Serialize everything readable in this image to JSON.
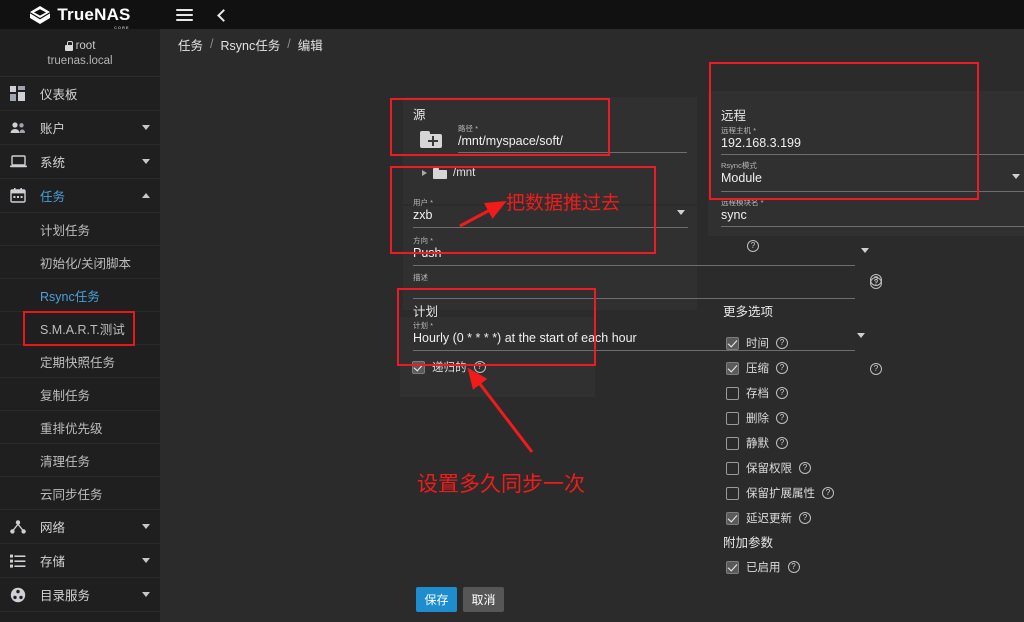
{
  "app": {
    "brand": "TrueNAS",
    "brand_sub": "CORE",
    "logo_icon": "truenas-diamond-logo",
    "menu_icon": "hamburger-menu-icon",
    "back_icon": "chevron-left-icon"
  },
  "sidebar": {
    "user": "root",
    "user_icon": "lock-icon",
    "host": "truenas.local",
    "items": [
      {
        "label": "仪表板",
        "icon": "dashboard-icon",
        "expandable": false
      },
      {
        "label": "账户",
        "icon": "users-icon",
        "expandable": true,
        "expanded": false
      },
      {
        "label": "系统",
        "icon": "laptop-icon",
        "expandable": true,
        "expanded": false
      },
      {
        "label": "任务",
        "icon": "calendar-icon",
        "expandable": true,
        "expanded": true,
        "active": true
      }
    ],
    "task_sub_items": [
      {
        "label": "计划任务",
        "selected": false
      },
      {
        "label": "初始化/关闭脚本",
        "selected": false
      },
      {
        "label": "Rsync任务",
        "selected": true
      },
      {
        "label": "S.M.A.R.T.测试",
        "selected": false
      },
      {
        "label": "定期快照任务",
        "selected": false
      },
      {
        "label": "复制任务",
        "selected": false
      },
      {
        "label": "重排优先级",
        "selected": false
      },
      {
        "label": "清理任务",
        "selected": false
      },
      {
        "label": "云同步任务",
        "selected": false
      }
    ],
    "bottom_items": [
      {
        "label": "网络",
        "icon": "network-icon",
        "expandable": true
      },
      {
        "label": "存储",
        "icon": "storage-icon",
        "expandable": true
      },
      {
        "label": "目录服务",
        "icon": "directory-service-icon",
        "expandable": true
      }
    ]
  },
  "breadcrumb": {
    "items": [
      "任务",
      "Rsync任务",
      "编辑"
    ],
    "separator": "/"
  },
  "source": {
    "title": "源",
    "path": {
      "label": "路径 *",
      "value": "/mnt/myspace/soft/",
      "help_icon": "help-circle-icon",
      "folder_icon": "folder-add-icon"
    },
    "tree": {
      "node": "/mnt",
      "icon": "folder-icon",
      "expand_icon": "triangle-right-icon"
    },
    "user": {
      "label": "用户 *",
      "value": "zxb",
      "help_icon": "help-circle-icon",
      "dropdown_icon": "caret-down-icon"
    },
    "direction": {
      "label": "方向 *",
      "value": "Push",
      "help_icon": "help-circle-icon",
      "dropdown_icon": "caret-down-icon"
    },
    "description": {
      "label": "描述",
      "value": "",
      "help_icon": "help-circle-icon"
    }
  },
  "remote": {
    "title": "远程",
    "host": {
      "label": "远程主机 *",
      "value": "192.168.3.199",
      "help_icon": "help-circle-icon"
    },
    "mode": {
      "label": "Rsync模式",
      "value": "Module",
      "help_icon": "help-circle-icon",
      "dropdown_icon": "caret-down-icon"
    },
    "module": {
      "label": "远程模块名 *",
      "value": "sync",
      "help_icon": "help-circle-icon"
    }
  },
  "schedule": {
    "title": "计划",
    "cron": {
      "label": "计划 *",
      "value": "Hourly (0 * * * *) at the start of each hour",
      "help_icon": "help-circle-icon",
      "dropdown_icon": "caret-down-icon"
    },
    "recursive": {
      "label": "递归的",
      "checked": true,
      "help_icon": "help-circle-icon"
    }
  },
  "more_options": {
    "title": "更多选项",
    "checkboxes": [
      {
        "label": "时间",
        "checked": true,
        "help_icon": "help-circle-icon"
      },
      {
        "label": "压缩",
        "checked": true,
        "help_icon": "help-circle-icon"
      },
      {
        "label": "存档",
        "checked": false,
        "help_icon": "help-circle-icon"
      },
      {
        "label": "删除",
        "checked": false,
        "help_icon": "help-circle-icon"
      },
      {
        "label": "静默",
        "checked": false,
        "help_icon": "help-circle-icon"
      },
      {
        "label": "保留权限",
        "checked": false,
        "help_icon": "help-circle-icon"
      },
      {
        "label": "保留扩展属性",
        "checked": false,
        "help_icon": "help-circle-icon"
      },
      {
        "label": "延迟更新",
        "checked": true,
        "help_icon": "help-circle-icon"
      }
    ]
  },
  "extra_params": {
    "title": "附加参数",
    "enabled": {
      "label": "已启用",
      "checked": true,
      "help_icon": "help-circle-icon"
    }
  },
  "actions": {
    "save": "保存",
    "cancel": "取消"
  },
  "annotations": {
    "color": "#f21b1b",
    "note_push": "把数据推过去",
    "note_schedule": "设置多久同步一次"
  },
  "colors": {
    "accent_blue": "#1e8dd0",
    "link_blue": "#4a9fd8",
    "annotation_red": "#ed1c24",
    "panel_bg": "#303030",
    "page_bg": "#2b2b2b",
    "sidebar_bg": "#1f1f1f",
    "topbar_bg": "#111111"
  }
}
